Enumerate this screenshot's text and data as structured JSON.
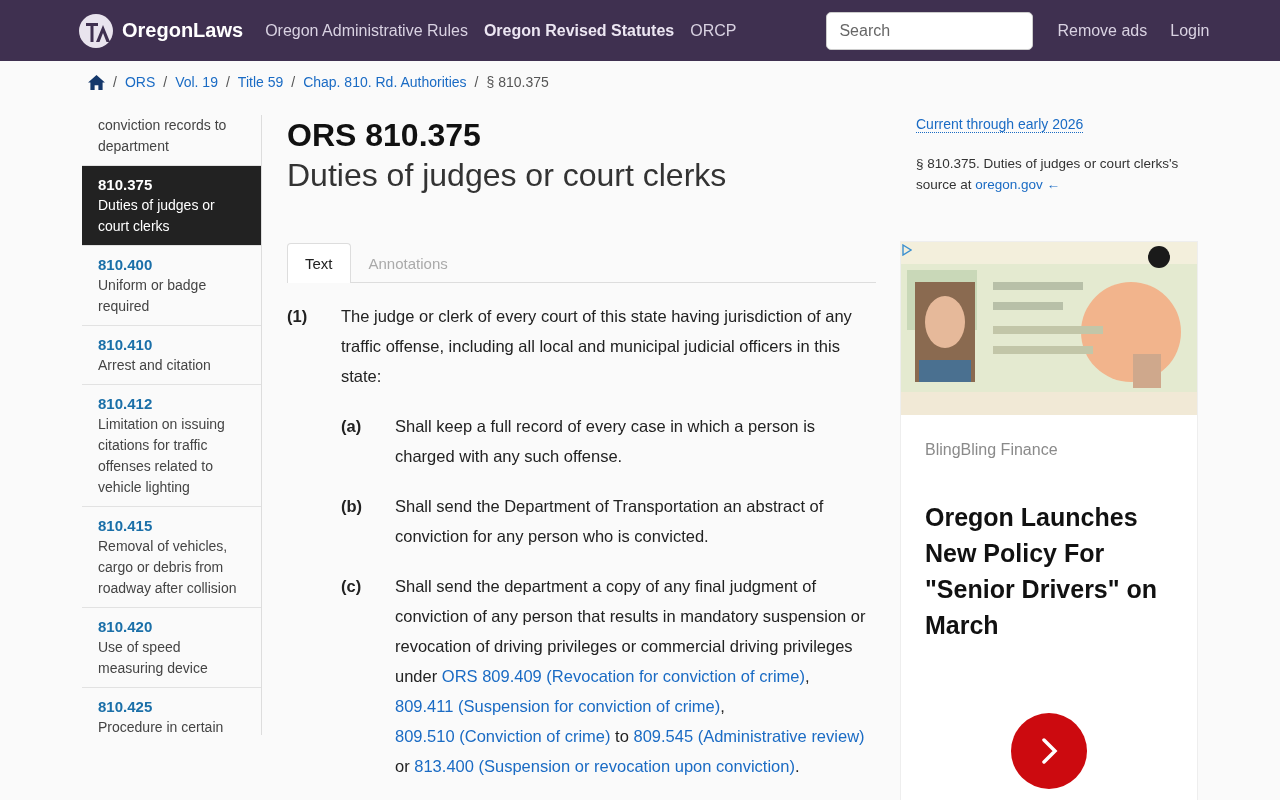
{
  "header": {
    "logo": "OregonLaws",
    "nav": [
      {
        "label": "Oregon Administrative Rules",
        "selected": false
      },
      {
        "label": "Oregon Revised Statutes",
        "selected": true
      },
      {
        "label": "ORCP",
        "selected": false
      }
    ],
    "search": {
      "placeholder": "Search"
    },
    "links": [
      "Remove ads",
      "Login"
    ]
  },
  "breadcrumb": {
    "items": [
      {
        "kind": "separator",
        "text": "/"
      },
      {
        "kind": "link",
        "text": "ORS"
      },
      {
        "kind": "separator",
        "text": "/"
      },
      {
        "kind": "link",
        "text": "Vol. 19"
      },
      {
        "kind": "separator",
        "text": "/"
      },
      {
        "kind": "link",
        "text": "Title 59"
      },
      {
        "kind": "separator",
        "text": "/"
      },
      {
        "kind": "link",
        "text": "Chap. 810. Rd. Authorities"
      },
      {
        "kind": "separator",
        "text": "/"
      },
      {
        "kind": "current",
        "text": "§ 810.375"
      }
    ]
  },
  "sidebar": {
    "items": [
      {
        "title": "conviction records to department",
        "selected": false
      },
      {
        "number": "810.375",
        "title": "Duties of judges or court clerks",
        "selected": true
      },
      {
        "number": "810.400",
        "title": "Uniform or badge required",
        "selected": false
      },
      {
        "number": "810.410",
        "title": "Arrest and citation",
        "selected": false
      },
      {
        "number": "810.412",
        "title": "Limitation on issuing citations for traffic offenses related to vehicle lighting",
        "selected": false
      },
      {
        "number": "810.415",
        "title": "Removal of vehicles, cargo or debris from roadway after collision",
        "selected": false
      },
      {
        "number": "810.420",
        "title": "Use of speed measuring device",
        "selected": false
      },
      {
        "number": "810.425",
        "title": "Procedure in certain",
        "selected": false
      }
    ]
  },
  "statute": {
    "number": "ORS 810.375",
    "title": "Duties of judges or court clerks",
    "tabs": [
      {
        "label": "Text",
        "selected": true
      },
      {
        "label": "Annotations",
        "selected": false
      }
    ],
    "sections": [
      {
        "label": "(1)",
        "segments": [
          {
            "kind": "text",
            "text": "The judge or clerk of every court of this state having jurisdiction of any traffic offense, including all local and municipal judicial officers in this state:"
          }
        ],
        "children": [
          {
            "label": "(a)",
            "segments": [
              {
                "kind": "text",
                "text": "Shall keep a full record of every case in which a person is charged with any such offense."
              }
            ]
          },
          {
            "label": "(b)",
            "segments": [
              {
                "kind": "text",
                "text": "Shall send the Department of Transportation an abstract of conviction for any person who is convicted."
              }
            ]
          },
          {
            "label": "(c)",
            "segments": [
              {
                "kind": "text",
                "text": "Shall send the department a copy of any final judgment of conviction of any person that results in mandatory suspension or revocation of driving privileges or commercial driving privileges under "
              },
              {
                "kind": "link",
                "text": "ORS 809.409 (Revocation for conviction of crime)"
              },
              {
                "kind": "text",
                "text": ", "
              },
              {
                "kind": "link",
                "text": "809.411 (Suspension for conviction of crime)"
              },
              {
                "kind": "text",
                "text": ", "
              },
              {
                "kind": "link",
                "text": "809.510 (Conviction of crime)"
              },
              {
                "kind": "text",
                "text": " to "
              },
              {
                "kind": "link",
                "text": "809.545 (Administrative review)"
              },
              {
                "kind": "text",
                "text": " or "
              },
              {
                "kind": "link",
                "text": "813.400 (Suspension or revocation upon conviction)"
              },
              {
                "kind": "text",
                "text": "."
              }
            ]
          }
        ]
      }
    ]
  },
  "aside": {
    "currency": "Current through early 2026",
    "source": {
      "text": "§ 810.375. Duties of judges or court clerks's source at ",
      "link": "oregon.gov ←"
    }
  },
  "ad": {
    "sponsor": "BlingBling Finance",
    "headline": "Oregon Launches New Policy For \"Senior Drivers\" on March"
  }
}
